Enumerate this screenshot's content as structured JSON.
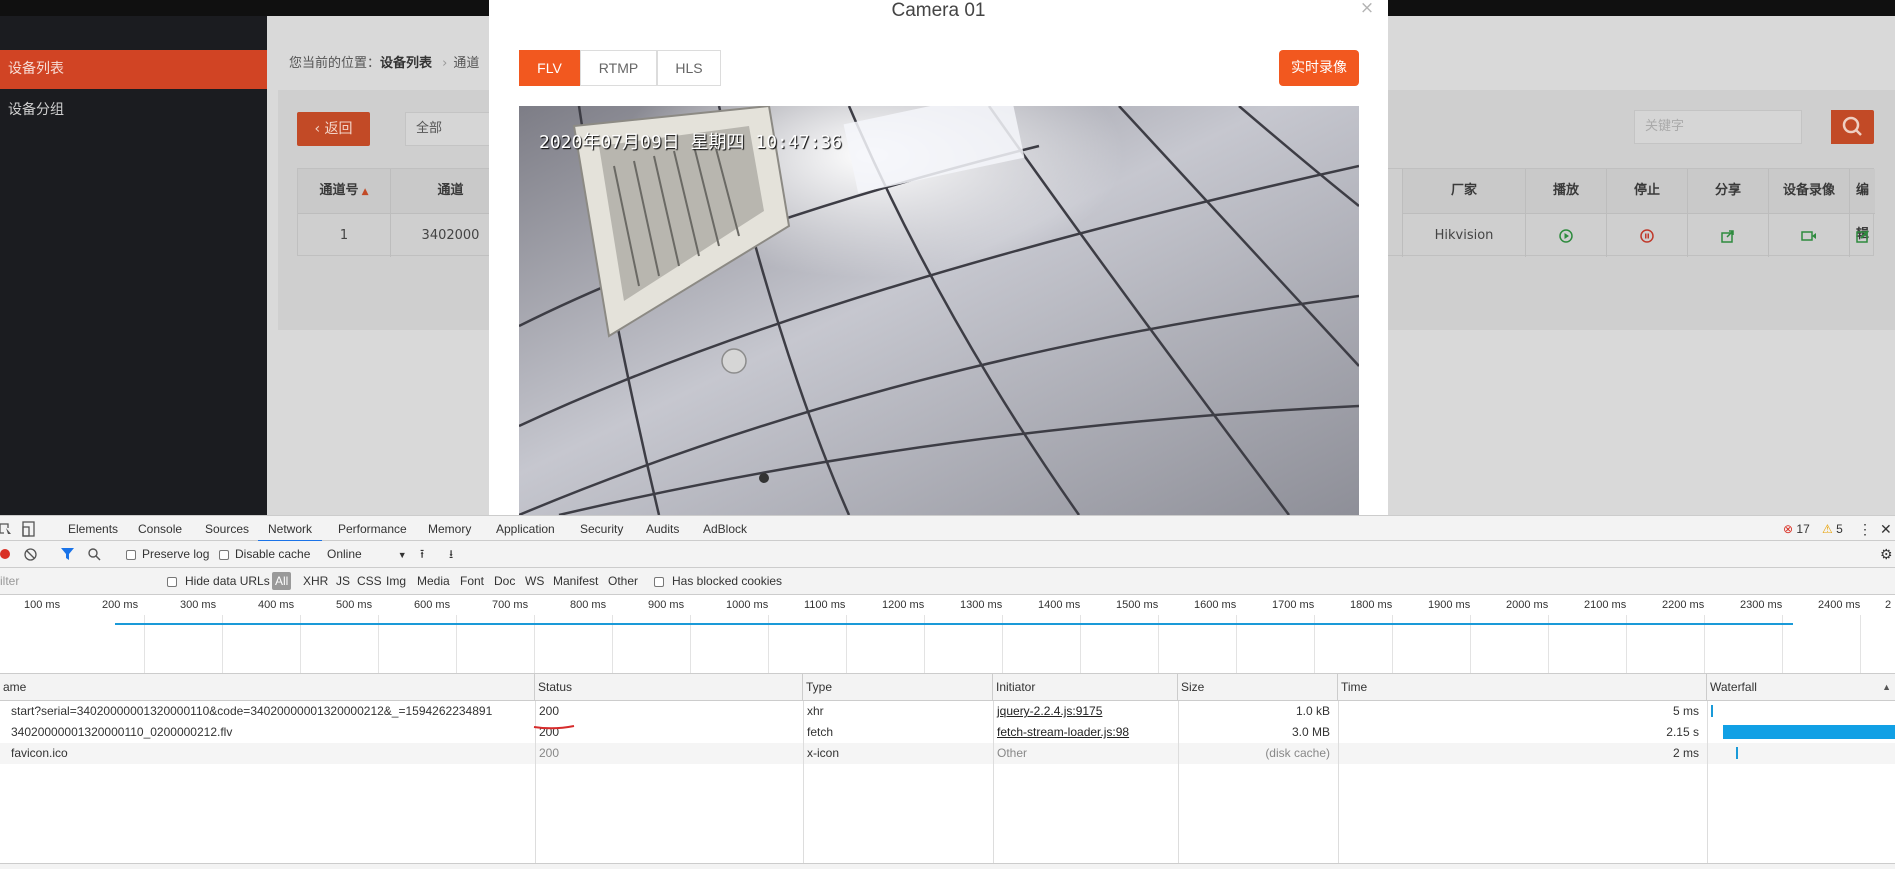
{
  "app": {
    "sidebar": {
      "items": [
        "设备列表",
        "设备分组"
      ]
    },
    "breadcrumb": {
      "prefix": "您当前的位置：",
      "current": "设备列表",
      "separator": "›",
      "next": "通道"
    },
    "back_label": "返回",
    "select_value": "全部",
    "search_placeholder": "关键字",
    "table": {
      "headers": [
        "通道号",
        "通道",
        "厂家",
        "播放",
        "停止",
        "分享",
        "设备录像",
        "编辑"
      ],
      "row": {
        "channel_no": "1",
        "channel": "3402000",
        "vendor": "Hikvision"
      }
    }
  },
  "modal": {
    "title": "Camera 01",
    "close": "×",
    "tabs": [
      "FLV",
      "RTMP",
      "HLS"
    ],
    "record_label": "实时录像",
    "osd_text": "2020年07月09日 星期四 10:47:36"
  },
  "devtools": {
    "tabs": [
      "Elements",
      "Console",
      "Sources",
      "Network",
      "Performance",
      "Memory",
      "Application",
      "Security",
      "Audits",
      "AdBlock"
    ],
    "errors": "17",
    "warnings": "5",
    "toolbar": {
      "preserve_log": "Preserve log",
      "disable_cache": "Disable cache",
      "throttle": "Online"
    },
    "filter": {
      "placeholder": "ilter",
      "hide_data_urls": "Hide data URLs",
      "types": [
        "All",
        "XHR",
        "JS",
        "CSS",
        "Img",
        "Media",
        "Font",
        "Doc",
        "WS",
        "Manifest",
        "Other"
      ],
      "has_blocked": "Has blocked cookies"
    },
    "timeline_ticks": [
      "100 ms",
      "200 ms",
      "300 ms",
      "400 ms",
      "500 ms",
      "600 ms",
      "700 ms",
      "800 ms",
      "900 ms",
      "1000 ms",
      "1100 ms",
      "1200 ms",
      "1300 ms",
      "1400 ms",
      "1500 ms",
      "1600 ms",
      "1700 ms",
      "1800 ms",
      "1900 ms",
      "2000 ms",
      "2100 ms",
      "2200 ms",
      "2300 ms",
      "2400 ms",
      "2"
    ],
    "columns": [
      "ame",
      "Status",
      "Type",
      "Initiator",
      "Size",
      "Time",
      "Waterfall"
    ],
    "rows": [
      {
        "name": "start?serial=34020000001320000110&code=34020000001320000212&_=1594262234891",
        "status": "200",
        "type": "xhr",
        "initiator": "jquery-2.2.4.js:9175",
        "size": "1.0 kB",
        "time": "5 ms"
      },
      {
        "name": "34020000001320000110_0200000212.flv",
        "status": "200",
        "type": "fetch",
        "initiator": "fetch-stream-loader.js:98",
        "size": "3.0 MB",
        "time": "2.15 s"
      },
      {
        "name": "favicon.ico",
        "status": "200",
        "type": "x-icon",
        "initiator": "Other",
        "size": "(disk cache)",
        "time": "2 ms"
      }
    ]
  }
}
